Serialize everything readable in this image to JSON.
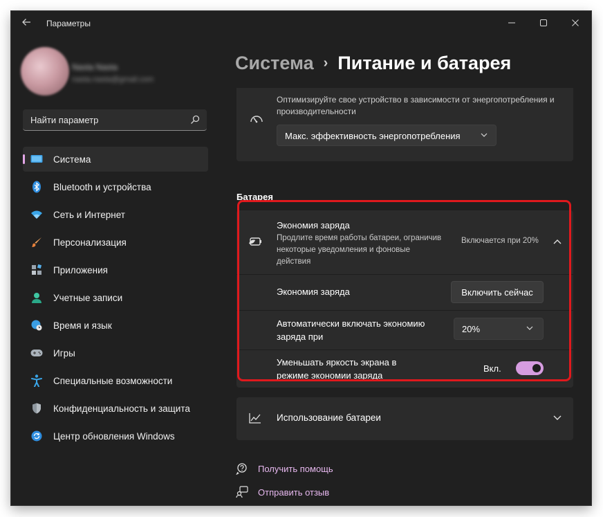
{
  "window": {
    "title": "Параметры"
  },
  "profile": {
    "name": "Nasta Nasta",
    "email": "nasta.nasta@gmail.com"
  },
  "search": {
    "placeholder": "Найти параметр"
  },
  "sidebar": {
    "items": [
      {
        "label": "Система",
        "icon": "system-icon",
        "active": true
      },
      {
        "label": "Bluetooth и устройства",
        "icon": "bluetooth-icon"
      },
      {
        "label": "Сеть и Интернет",
        "icon": "wifi-icon"
      },
      {
        "label": "Персонализация",
        "icon": "brush-icon"
      },
      {
        "label": "Приложения",
        "icon": "apps-icon"
      },
      {
        "label": "Учетные записи",
        "icon": "person-icon"
      },
      {
        "label": "Время и язык",
        "icon": "globe-clock-icon"
      },
      {
        "label": "Игры",
        "icon": "gamepad-icon"
      },
      {
        "label": "Специальные возможности",
        "icon": "accessibility-icon"
      },
      {
        "label": "Конфиденциальность и защита",
        "icon": "shield-icon"
      },
      {
        "label": "Центр обновления Windows",
        "icon": "update-icon"
      }
    ]
  },
  "breadcrumb": {
    "parent": "Система",
    "separator": "›",
    "current": "Питание и батарея"
  },
  "power_mode": {
    "description": "Оптимизируйте свое устройство в зависимости от энергопотребления и производительности",
    "selected": "Макс. эффективность энергопотребления"
  },
  "battery": {
    "section_title": "Батарея",
    "saver": {
      "title": "Экономия заряда",
      "description": "Продлите время работы батареи, ограничив некоторые уведомления и фоновые действия",
      "status": "Включается при 20%",
      "rows": {
        "now_label": "Экономия заряда",
        "now_button": "Включить сейчас",
        "auto_label": "Автоматически включать экономию заряда при",
        "auto_value": "20%",
        "dim_label": "Уменьшать яркость экрана в режиме экономии заряда",
        "dim_state": "Вкл.",
        "dim_on": true
      }
    },
    "usage": {
      "label": "Использование батареи"
    }
  },
  "links": {
    "help": "Получить помощь",
    "feedback": "Отправить отзыв"
  },
  "colors": {
    "accent": "#e2a6e6",
    "toggle_on": "#d69ce0",
    "highlight": "#e0191d",
    "link": "#e7b8ef",
    "background": "#202020",
    "card": "#2b2b2b"
  }
}
